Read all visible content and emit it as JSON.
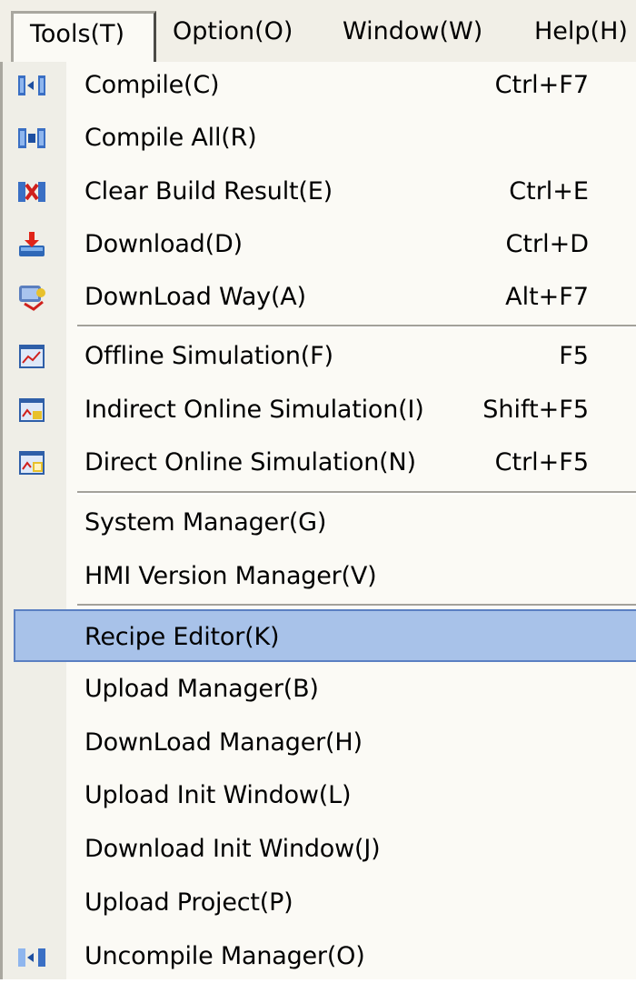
{
  "menubar": {
    "items": [
      {
        "label": "Tools(T)"
      },
      {
        "label": "Option(O)"
      },
      {
        "label": "Window(W)"
      },
      {
        "label": "Help(H)"
      }
    ]
  },
  "menu": {
    "items": [
      {
        "label": "Compile(C)",
        "shortcut": "Ctrl+F7",
        "icon": "compile-icon"
      },
      {
        "label": "Compile All(R)",
        "shortcut": "",
        "icon": "compile-all-icon"
      },
      {
        "label": "Clear Build Result(E)",
        "shortcut": "Ctrl+E",
        "icon": "clear-build-icon"
      },
      {
        "label": "Download(D)",
        "shortcut": "Ctrl+D",
        "icon": "download-icon"
      },
      {
        "label": "DownLoad Way(A)",
        "shortcut": "Alt+F7",
        "icon": "download-way-icon"
      },
      {
        "label": "Offline Simulation(F)",
        "shortcut": "F5",
        "icon": "offline-simulation-icon"
      },
      {
        "label": "Indirect Online Simulation(I)",
        "shortcut": "Shift+F5",
        "icon": "indirect-online-simulation-icon"
      },
      {
        "label": "Direct Online Simulation(N)",
        "shortcut": "Ctrl+F5",
        "icon": "direct-online-simulation-icon"
      },
      {
        "label": "System Manager(G)",
        "shortcut": ""
      },
      {
        "label": "HMI Version Manager(V)",
        "shortcut": ""
      },
      {
        "label": "Recipe Editor(K)",
        "shortcut": "",
        "selected": true
      },
      {
        "label": "Upload Manager(B)",
        "shortcut": ""
      },
      {
        "label": "DownLoad Manager(H)",
        "shortcut": ""
      },
      {
        "label": "Upload Init Window(L)",
        "shortcut": ""
      },
      {
        "label": "Download Init Window(J)",
        "shortcut": ""
      },
      {
        "label": "Upload Project(P)",
        "shortcut": ""
      },
      {
        "label": "Uncompile Manager(O)",
        "shortcut": "",
        "icon": "uncompile-icon"
      }
    ]
  },
  "colors": {
    "selection": "#a8c2e9",
    "selection_border": "#5a7fc2",
    "menu_bg": "#fbfaf5",
    "gutter_bg": "#efeee7"
  }
}
